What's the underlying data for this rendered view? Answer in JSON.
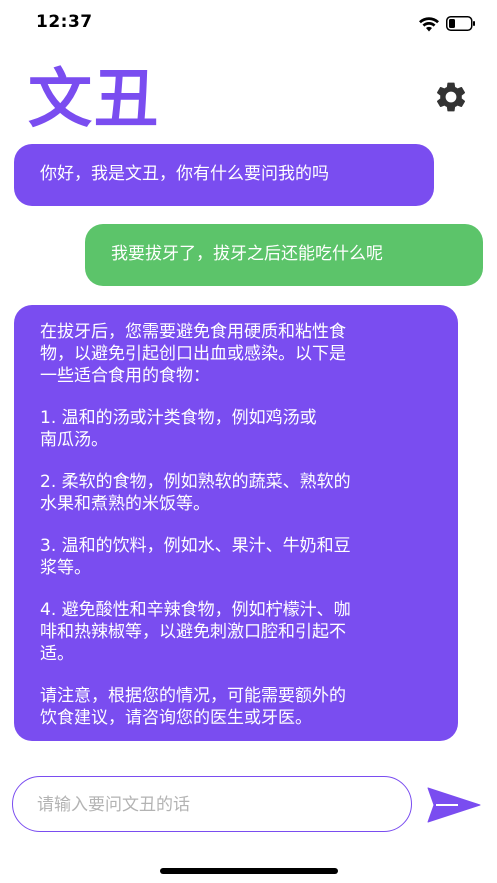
{
  "status_bar": {
    "time": "12:37"
  },
  "app": {
    "title": "文丑"
  },
  "messages": {
    "greeting": "你好，我是文丑，你有什么要问我的吗",
    "user_question": "我要拔牙了，拔牙之后还能吃什么呢",
    "answer_paragraphs": [
      "在拔牙后，您需要避免食用硬质和粘性食\n物，以避免引起创口出血或感染。以下是\n一些适合食用的食物：",
      "1. 温和的汤或汁类食物，例如鸡汤或\n南瓜汤。",
      "2. 柔软的食物，例如熟软的蔬菜、熟软的\n水果和煮熟的米饭等。",
      "3. 温和的饮料，例如水、果汁、牛奶和豆\n浆等。",
      "4. 避免酸性和辛辣食物，例如柠檬汁、咖\n啡和热辣椒等，以避免刺激口腔和引起不\n适。",
      "请注意，根据您的情况，可能需要额外的\n饮食建议，请咨询您的医生或牙医。"
    ]
  },
  "input": {
    "placeholder": "请输入要问文丑的话",
    "value": ""
  },
  "icons": {
    "settings": "gear-icon",
    "send": "send-icon",
    "wifi": "wifi-icon",
    "battery": "battery-icon"
  },
  "colors": {
    "bot_bubble": "#7a4df0",
    "user_bubble": "#5cc46a",
    "accent": "#7a4df0"
  }
}
